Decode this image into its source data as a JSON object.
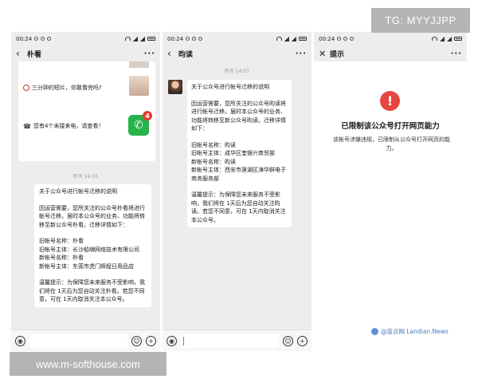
{
  "watermarks": {
    "tg": "TG: MYYJJPP",
    "site": "www.m-softhouse.com",
    "source": "@蓝点网 Landian.News"
  },
  "status": {
    "time": "00:24"
  },
  "phone1": {
    "title": "朴看",
    "promo_line1": "三分钟的短片，你敢看完吗?",
    "promo_line2": "您有4个未接来电，请查看！",
    "badge_count": "4",
    "timestamp": "昨天 14:05",
    "message": [
      "关于公众号进行帐号迁移的说明",
      "",
      "因运营需要，您所关注的公众号朴看将进行帐号迁移。届时本公众号的业务、功能将转移至新公众号朴看。迁移详情如下：",
      "",
      "旧帐号名称：朴看",
      "旧帐号主体：长沙船嗨网络技术有限公司",
      "新帐号名称：朴看",
      "新帐号主体：东莞市虎门辉程日用品店",
      "",
      "温馨提示：为保障您未来服务不受影响，我们将在 1天后为您自动关注朴看。若您不同意，可在 1天内取消关注本公众号。"
    ]
  },
  "phone2": {
    "title": "昀读",
    "timestamp": "昨天 14:07",
    "message": [
      "关于公众号进行帐号迁移的说明",
      "",
      "因运营需要，您所关注的公众号昀读将进行帐号迁移。届时本公众号的业务、功能将转移至新公众号昀读。迁移详情如下：",
      "",
      "旧帐号名称：昀读",
      "旧帐号主体：成华区奎银兴商贸部",
      "新帐号名称：昀读",
      "新帐号主体：西安市莲湖区涛华鲜电子商务服务部",
      "",
      "温馨提示：为保障您未来服务不受影响，我们将在 1天后为您自动关注昀读。若您不同意，可在 1天内取消关注本公众号。"
    ]
  },
  "phone3": {
    "title": "提示",
    "heading": "已限制该公众号打开网页能力",
    "body": "该帐号涉嫌违规，已限制从公众号打开网页的能力。"
  },
  "colors": {
    "warning": "#e6463d",
    "call_green": "#27b24a",
    "badge_red": "#e23c2e"
  }
}
